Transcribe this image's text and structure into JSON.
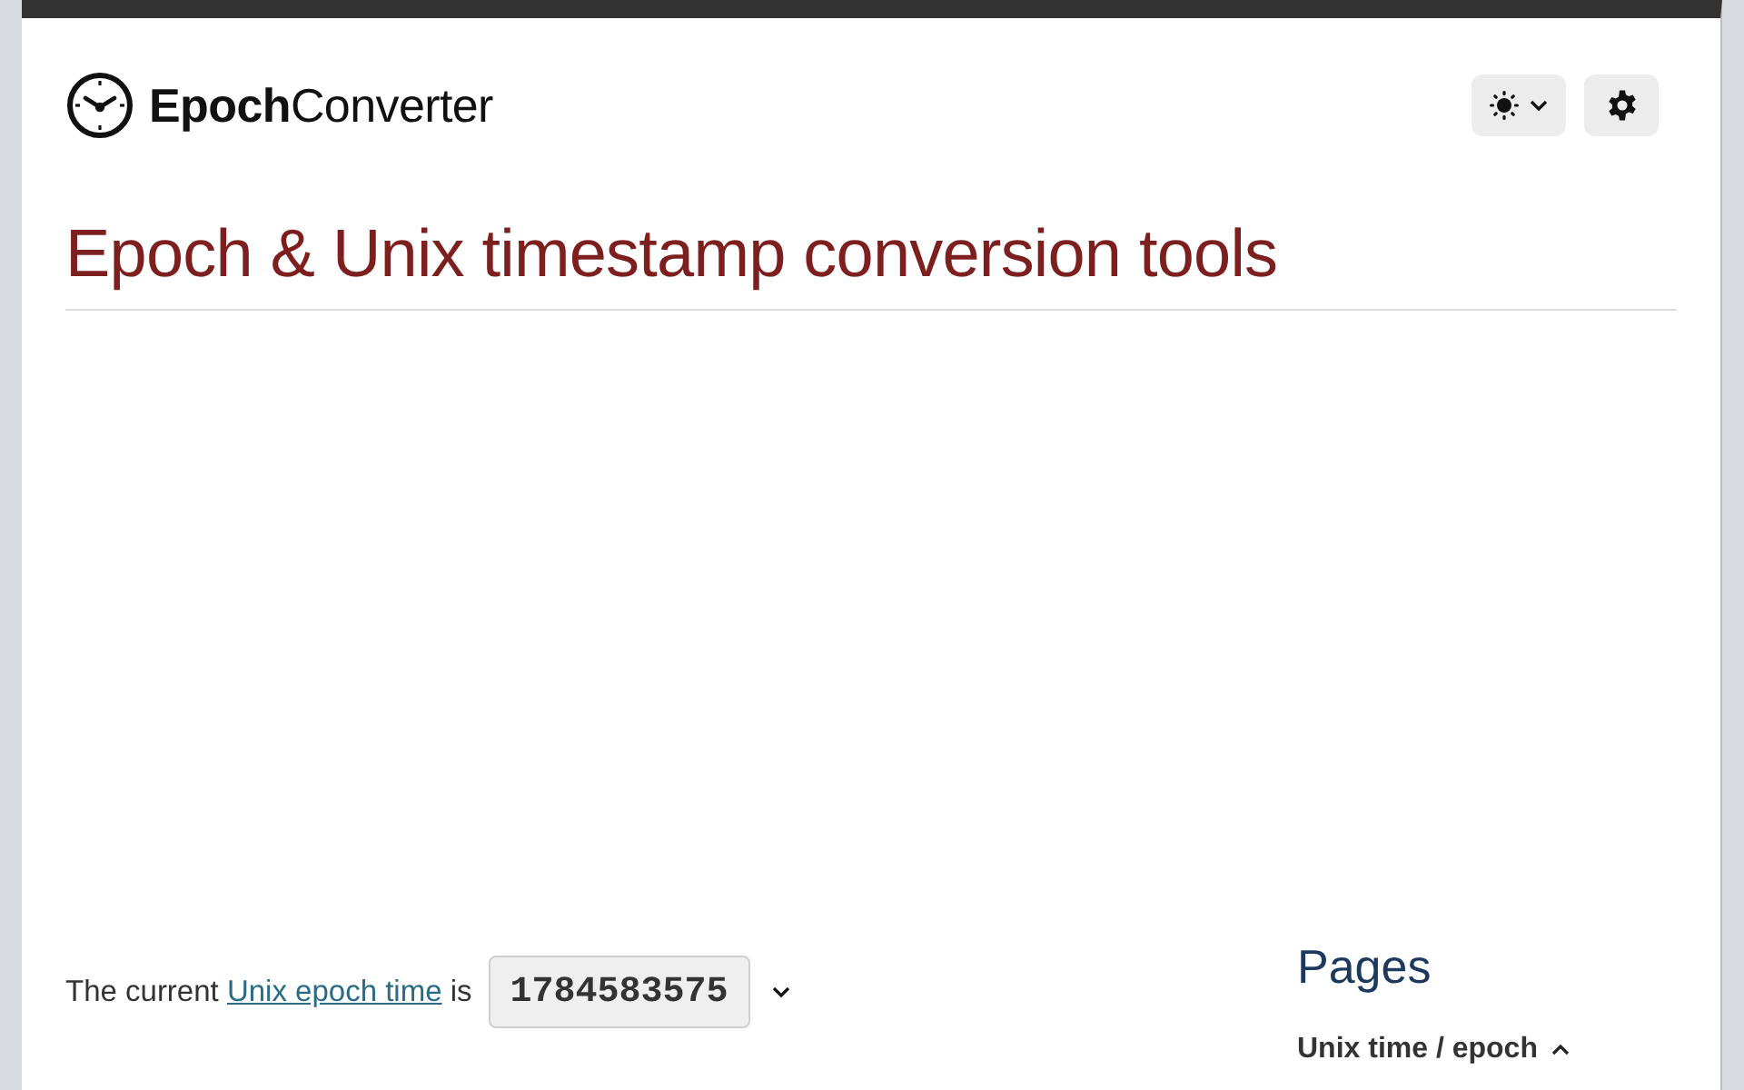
{
  "logo": "**Epoch**Converter",
  "heading": "Epoch & Unix timestamp conversion tools",
  "current_time": {
    "prefix": "The current",
    "link": "Unix epoch time",
    "suffix": "is",
    "value": "1784583575"
  },
  "sidebar": {
    "title": "Pages",
    "sections": [
      {
        "label": "Unix time / epoch",
        "expanded": true
      }
    ]
  }
}
